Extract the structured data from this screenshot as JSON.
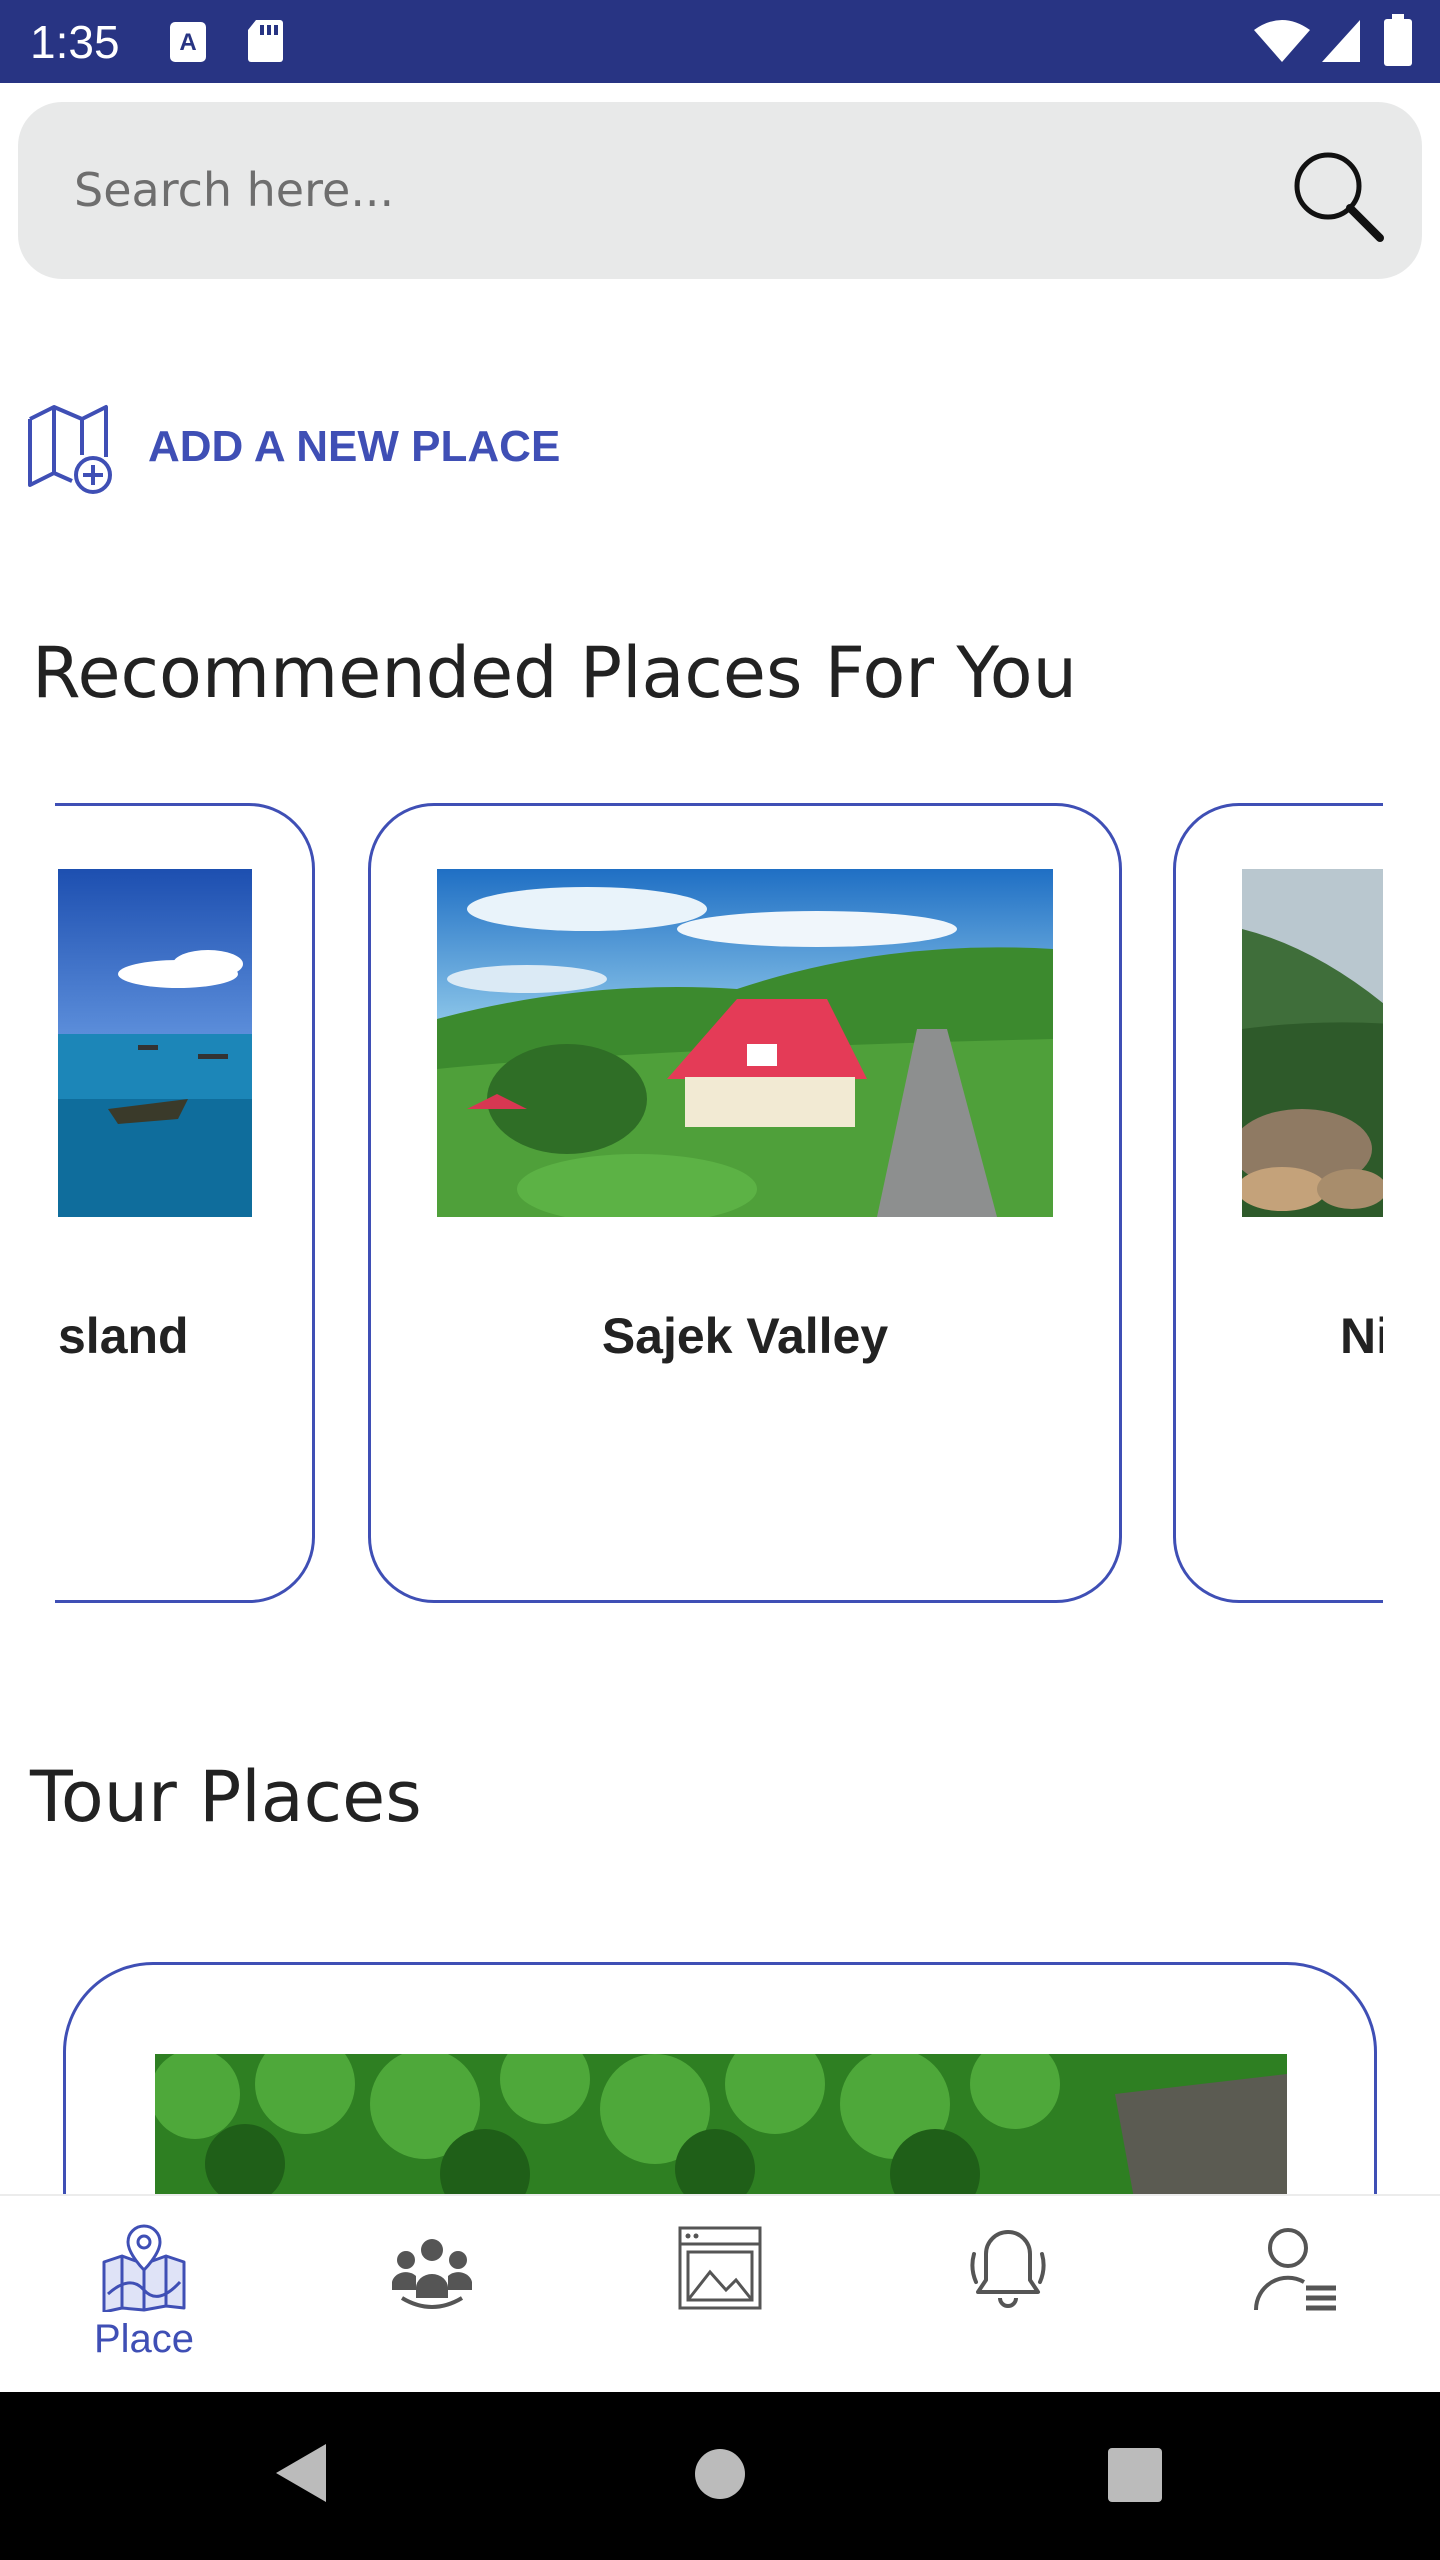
{
  "status_bar": {
    "time": "1:35"
  },
  "search": {
    "placeholder": "Search here..."
  },
  "add_place": {
    "label": "ADD A NEW PLACE"
  },
  "recommended": {
    "title": "Recommended Places For You",
    "cards": [
      {
        "name": "sland"
      },
      {
        "name": "Sajek Valley"
      },
      {
        "name": "Ni"
      }
    ]
  },
  "tour": {
    "title": "Tour Places"
  },
  "bottom_nav": {
    "items": [
      {
        "label": "Place",
        "icon": "map-pin-icon",
        "active": true
      },
      {
        "icon": "group-icon"
      },
      {
        "icon": "gallery-icon"
      },
      {
        "icon": "bell-icon"
      },
      {
        "icon": "profile-icon"
      }
    ]
  },
  "colors": {
    "accent": "#3f4fb5",
    "status_bar": "#283483",
    "search_bg": "#e8e9e9"
  }
}
